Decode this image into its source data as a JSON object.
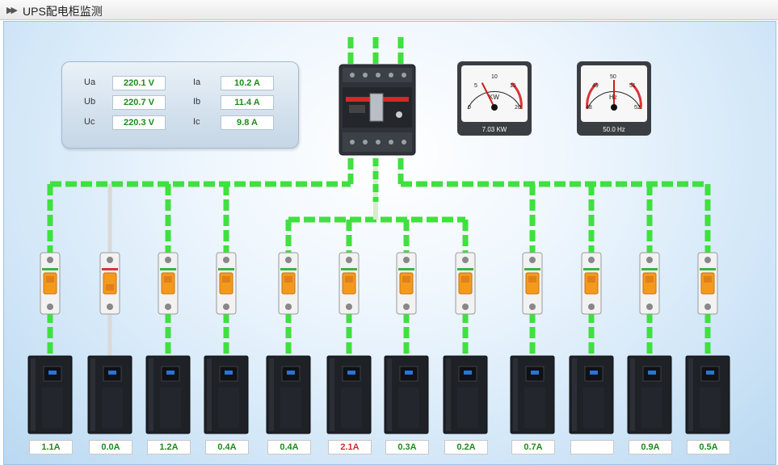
{
  "window": {
    "title": "UPS配电柜监测"
  },
  "meters": {
    "voltages": [
      {
        "label": "Ua",
        "value": "220.1 V"
      },
      {
        "label": "Ub",
        "value": "220.7 V"
      },
      {
        "label": "Uc",
        "value": "220.3 V"
      }
    ],
    "currents": [
      {
        "label": "Ia",
        "value": "10.2 A"
      },
      {
        "label": "Ib",
        "value": "11.4 A"
      },
      {
        "label": "Ic",
        "value": "9.8 A"
      }
    ]
  },
  "power_gauge": {
    "unit": "KW",
    "readout": "7.03 KW",
    "ticks": [
      "0",
      "5",
      "10",
      "15",
      "20"
    ],
    "value": 7.03,
    "min": 0,
    "max": 20
  },
  "freq_gauge": {
    "unit": "Hz",
    "readout": "50.0 Hz",
    "ticks": [
      "48",
      "49",
      "50",
      "51",
      "52"
    ],
    "value": 50.0,
    "min": 48,
    "max": 52
  },
  "colors": {
    "bus_active": "#3fe03f",
    "bus_inactive": "#d9d9d9",
    "value_normal": "#1d8a1d",
    "value_alarm": "#d42a2a"
  },
  "branches": [
    {
      "current": "1.1A",
      "active": true,
      "alarm": false
    },
    {
      "current": "0.0A",
      "active": false,
      "alarm": false
    },
    {
      "current": "1.2A",
      "active": true,
      "alarm": false
    },
    {
      "current": "0.4A",
      "active": true,
      "alarm": false
    },
    {
      "current": "0.4A",
      "active": true,
      "alarm": false
    },
    {
      "current": "2.1A",
      "active": true,
      "alarm": true
    },
    {
      "current": "0.3A",
      "active": true,
      "alarm": false
    },
    {
      "current": "0.2A",
      "active": true,
      "alarm": false
    },
    {
      "current": "0.7A",
      "active": true,
      "alarm": false
    },
    {
      "current": "",
      "active": true,
      "alarm": false
    },
    {
      "current": "0.9A",
      "active": true,
      "alarm": false
    },
    {
      "current": "0.5A",
      "active": true,
      "alarm": false
    }
  ]
}
